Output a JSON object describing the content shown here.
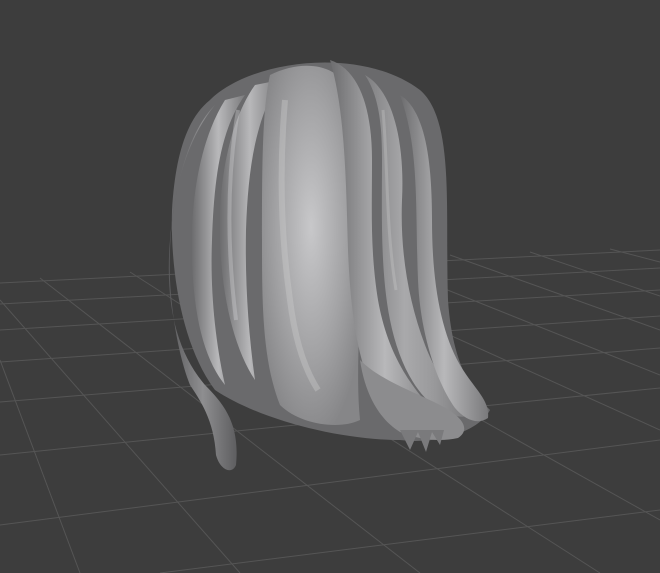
{
  "viewport": {
    "background": "#3d3d3d",
    "grid_line_color": "#555555",
    "shading": "solid",
    "grid": "floor-grid"
  },
  "object": {
    "type": "hair-mesh",
    "base_color": "#9a9a9c",
    "highlight_color": "#c4c4c6",
    "shadow_color": "#5e5e60"
  }
}
